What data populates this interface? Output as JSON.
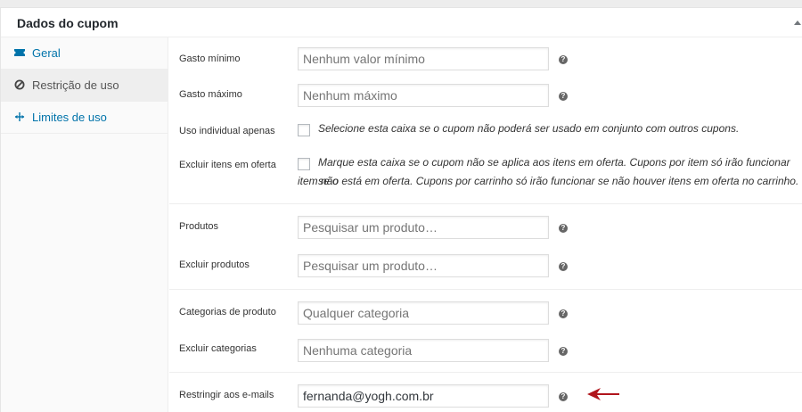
{
  "panel": {
    "title": "Dados do cupom"
  },
  "tabs": [
    {
      "label": "Geral",
      "icon": "ticket-icon",
      "state": "link"
    },
    {
      "label": "Restrição de uso",
      "icon": "ban-icon",
      "state": "active"
    },
    {
      "label": "Limites de uso",
      "icon": "limit-icon",
      "state": "link"
    }
  ],
  "fields": {
    "min_spend": {
      "label": "Gasto mínimo",
      "placeholder": "Nenhum valor mínimo"
    },
    "max_spend": {
      "label": "Gasto máximo",
      "placeholder": "Nenhum máximo"
    },
    "individual_use": {
      "label": "Uso individual apenas",
      "description": "Selecione esta caixa se o cupom não poderá ser usado em conjunto com outros cupons."
    },
    "exclude_sale": {
      "label": "Excluir itens em oferta",
      "description_line1": "Marque esta caixa se o cupom não se aplica aos itens em oferta. Cupons por item só irão funcionar se o",
      "description_line2": "item não está em oferta. Cupons por carrinho só irão funcionar se não houver itens em oferta no carrinho."
    },
    "products": {
      "label": "Produtos",
      "placeholder": "Pesquisar um produto…"
    },
    "exclude_products": {
      "label": "Excluir produtos",
      "placeholder": "Pesquisar um produto…"
    },
    "categories": {
      "label": "Categorias de produto",
      "placeholder": "Qualquer categoria"
    },
    "exclude_categories": {
      "label": "Excluir categorias",
      "placeholder": "Nenhuma categoria"
    },
    "emails": {
      "label": "Restringir aos e-mails",
      "value": "fernanda@yogh.com.br"
    }
  },
  "help_glyph": "?",
  "colors": {
    "link": "#0073aa",
    "arrow": "#b0151c",
    "help": "#666666"
  }
}
